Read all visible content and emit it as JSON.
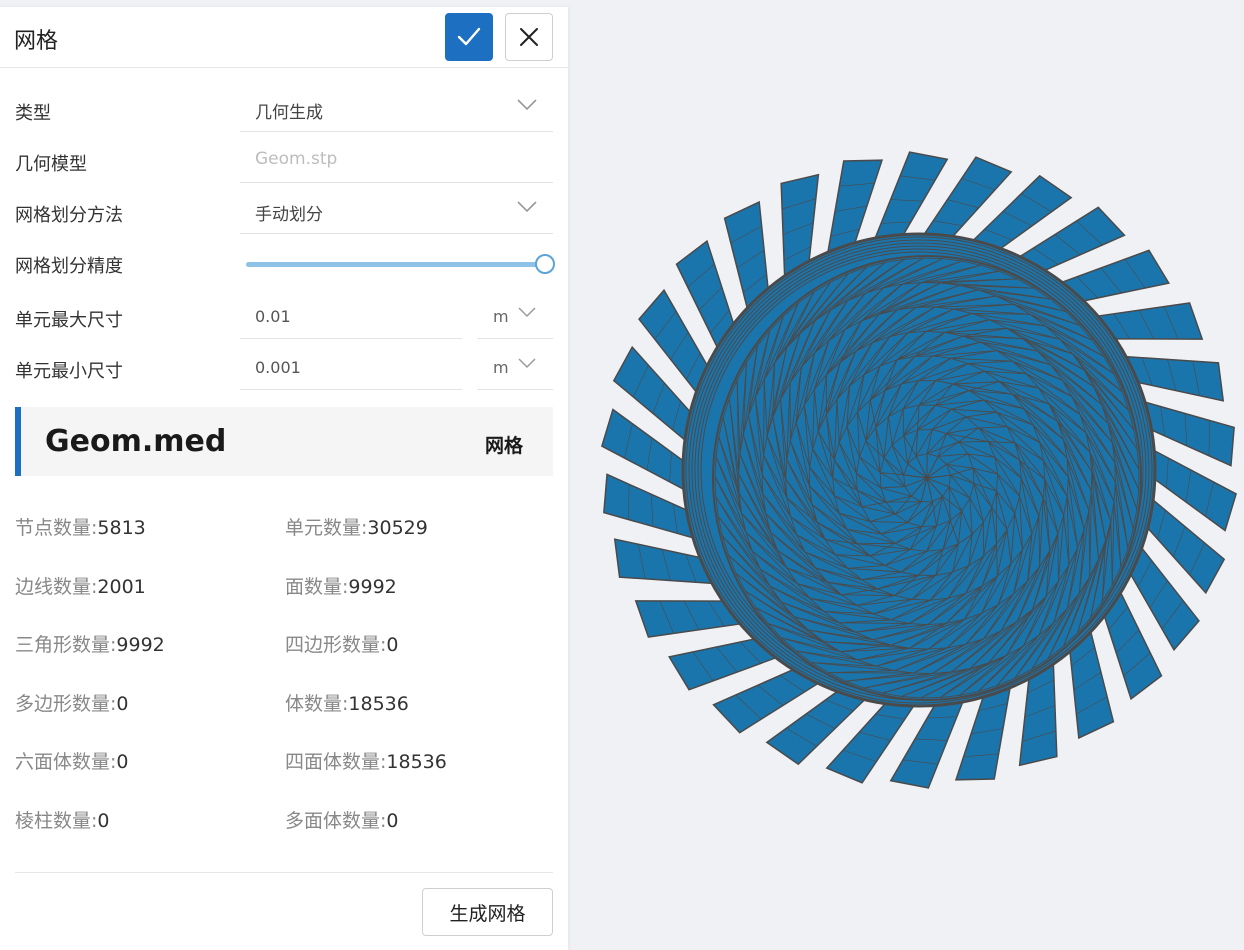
{
  "dialog": {
    "title": "网格",
    "confirm_icon": "check-icon",
    "close_icon": "close-icon"
  },
  "form": {
    "type": {
      "label": "类型",
      "value": "几何生成"
    },
    "geometry_model": {
      "label": "几何模型",
      "placeholder": "Geom.stp"
    },
    "mesh_method": {
      "label": "网格划分方法",
      "value": "手动划分"
    },
    "mesh_precision": {
      "label": "网格划分精度",
      "value_fraction": 1.0
    },
    "max_element_size": {
      "label": "单元最大尺寸",
      "value": "0.01",
      "unit": "m"
    },
    "min_element_size": {
      "label": "单元最小尺寸",
      "value": "0.001",
      "unit": "m"
    }
  },
  "result": {
    "file_name": "Geom.med",
    "tag": "网格",
    "stats": {
      "nodes": {
        "label": "节点数量:",
        "value": "5813"
      },
      "elements": {
        "label": "单元数量:",
        "value": "30529"
      },
      "edges": {
        "label": "边线数量:",
        "value": "2001"
      },
      "faces": {
        "label": "面数量:",
        "value": "9992"
      },
      "triangles": {
        "label": "三角形数量:",
        "value": "9992"
      },
      "quads": {
        "label": "四边形数量:",
        "value": "0"
      },
      "polygons": {
        "label": "多边形数量:",
        "value": "0"
      },
      "volumes": {
        "label": "体数量:",
        "value": "18536"
      },
      "hexahedra": {
        "label": "六面体数量:",
        "value": "0"
      },
      "tetrahedra": {
        "label": "四面体数量:",
        "value": "18536"
      },
      "prisms": {
        "label": "棱柱数量:",
        "value": "0"
      },
      "polyhedra": {
        "label": "多面体数量:",
        "value": "0"
      }
    }
  },
  "actions": {
    "generate_label": "生成网格"
  },
  "colors": {
    "primary": "#1d6fc1",
    "mesh_fill": "#1b75ad",
    "mesh_edge": "#4a4a4a",
    "slider": "#8ec2e6",
    "background": "#f0f1f5"
  }
}
